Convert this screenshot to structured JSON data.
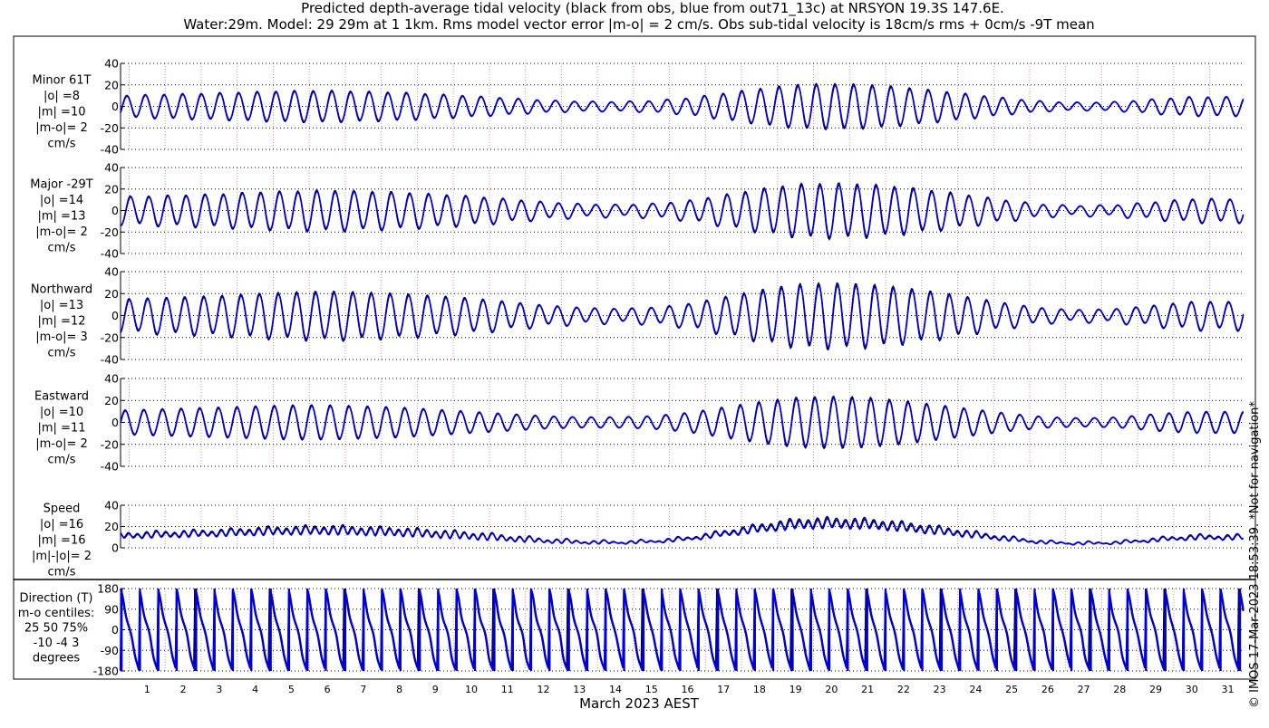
{
  "chart_data": {
    "type": "line",
    "title": [
      "Predicted depth-average tidal velocity (black from obs, blue from out71_13c) at NRSYON 19.3S 147.6E.",
      "Water:29m. Model: 29 29m at 1 1km. Rms model vector error |m-o| = 2 cm/s. Obs sub-tidal velocity is 18cm/s rms + 0cm/s -9T mean"
    ],
    "xlabel": "March 2023 AEST",
    "x_ticks": [
      "1",
      "2",
      "3",
      "4",
      "5",
      "6",
      "7",
      "8",
      "9",
      "10",
      "11",
      "12",
      "13",
      "14",
      "15",
      "16",
      "17",
      "18",
      "19",
      "20",
      "21",
      "22",
      "23",
      "24",
      "25",
      "26",
      "27",
      "28",
      "29",
      "30",
      "31"
    ],
    "xlim_days": [
      0.76,
      31.94
    ],
    "series_legend": {
      "obs": "black",
      "model": "blue"
    },
    "colors": {
      "obs": "#000000",
      "model": "#0000dd",
      "grid": "#000000",
      "day_grid": "#e08a8a"
    },
    "tidal_period_hours": 12.42,
    "daily_amplitude_northward": [
      14,
      15,
      16,
      17,
      19,
      20,
      21,
      20,
      19,
      17,
      15,
      12,
      9,
      7,
      6,
      7,
      10,
      16,
      22,
      27,
      28,
      27,
      24,
      20,
      15,
      10,
      6,
      5,
      6,
      9,
      12
    ],
    "daily_amplitude_eastward": [
      11,
      12,
      13,
      14,
      15,
      16,
      16,
      15,
      14,
      12,
      10,
      8,
      6,
      5,
      5,
      6,
      9,
      14,
      19,
      23,
      24,
      23,
      20,
      16,
      12,
      8,
      5,
      4,
      5,
      8,
      10
    ],
    "panels": [
      {
        "id": "minor",
        "lines": [
          "Minor 61T",
          "|o| =8",
          "|m| =10",
          "|m-o|= 2",
          "cm/s"
        ],
        "yticks": [
          "40",
          "20",
          "0",
          "-20",
          "-40"
        ],
        "ylim": [
          -40,
          40
        ]
      },
      {
        "id": "major",
        "lines": [
          "Major -29T",
          "|o| =14",
          "|m| =13",
          "|m-o|= 2",
          "cm/s"
        ],
        "yticks": [
          "40",
          "20",
          "0",
          "-20",
          "-40"
        ],
        "ylim": [
          -40,
          40
        ]
      },
      {
        "id": "north",
        "lines": [
          "Northward",
          "|o| =13",
          "|m| =12",
          "|m-o|= 3",
          "cm/s"
        ],
        "yticks": [
          "40",
          "20",
          "0",
          "-20",
          "-40"
        ],
        "ylim": [
          -40,
          40
        ]
      },
      {
        "id": "east",
        "lines": [
          "Eastward",
          "|o| =10",
          "|m| =11",
          "|m-o|= 2",
          "cm/s"
        ],
        "yticks": [
          "40",
          "20",
          "0",
          "-20",
          "-40"
        ],
        "ylim": [
          -40,
          40
        ]
      },
      {
        "id": "speed",
        "lines": [
          "Speed",
          "|o| =16",
          "|m| =16",
          "|m|-|o|= 2",
          "cm/s"
        ],
        "yticks": [
          "40",
          "20",
          "0"
        ],
        "ylim": [
          0,
          40
        ]
      },
      {
        "id": "direction",
        "lines": [
          "Direction (T)",
          "m-o centiles:",
          "25  50  75%",
          "-10  -4    3",
          "degrees"
        ],
        "yticks": [
          "180",
          "90",
          "0",
          "-90",
          "-180"
        ],
        "ylim": [
          -180,
          180
        ]
      }
    ]
  },
  "footer": {
    "credit": "© IMOS 17-Mar-2023 18:53:39. *Not for navigation*"
  }
}
